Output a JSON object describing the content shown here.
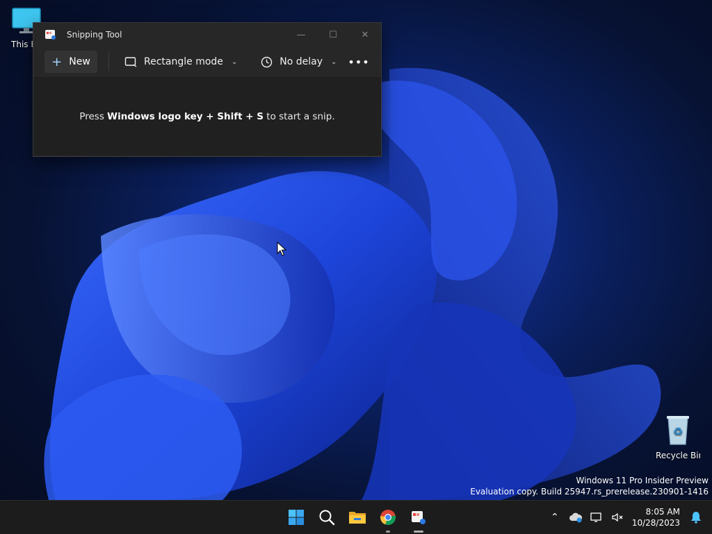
{
  "desktop": {
    "this_pc_label": "This PC",
    "recycle_bin_label": "Recycle Bin",
    "watermark_line1": "Windows 11 Pro Insider Preview",
    "watermark_line2": "Evaluation copy. Build 25947.rs_prerelease.230901-1416"
  },
  "window": {
    "title": "Snipping Tool",
    "new_label": "New",
    "mode_label": "Rectangle mode",
    "delay_label": "No delay",
    "more_glyph": "•••",
    "hint_prefix": "Press ",
    "hint_keys": "Windows logo key + Shift + S",
    "hint_suffix": " to start a snip."
  },
  "taskbar": {
    "time": "8:05 AM",
    "date": "10/28/2023",
    "apps": [
      "start-icon",
      "search-icon",
      "file-explorer-icon",
      "chrome-icon",
      "snipping-tool-icon"
    ]
  },
  "colors": {
    "window_bg": "#272727",
    "content_bg": "#202020",
    "taskbar_bg": "#1c1c1c",
    "accent": "#4cc2ff"
  }
}
